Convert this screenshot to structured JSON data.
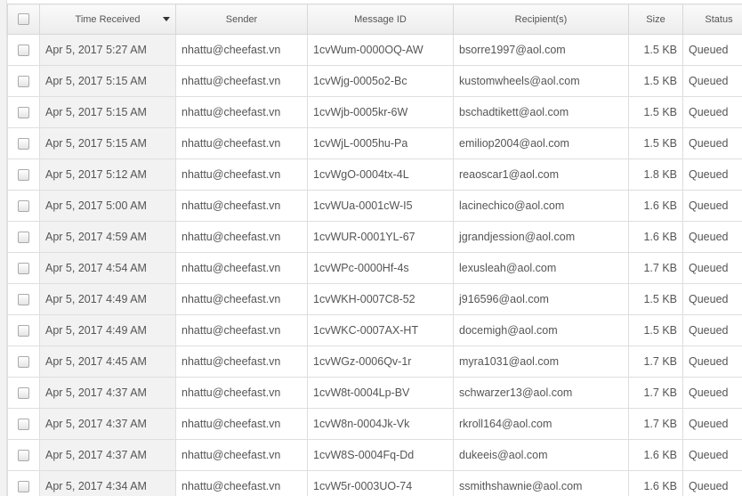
{
  "columns": {
    "time": "Time Received",
    "sender": "Sender",
    "message_id": "Message ID",
    "recipients": "Recipient(s)",
    "size": "Size",
    "status": "Status"
  },
  "sort": {
    "column": "time",
    "direction": "descending"
  },
  "rows": [
    {
      "time": "Apr 5, 2017 5:27 AM",
      "sender": "nhattu@cheefast.vn",
      "message_id": "1cvWum-0000OQ-AW",
      "recipient": "bsorre1997@aol.com",
      "size": "1.5 KB",
      "status": "Queued"
    },
    {
      "time": "Apr 5, 2017 5:15 AM",
      "sender": "nhattu@cheefast.vn",
      "message_id": "1cvWjg-0005o2-Bc",
      "recipient": "kustomwheels@aol.com",
      "size": "1.5 KB",
      "status": "Queued"
    },
    {
      "time": "Apr 5, 2017 5:15 AM",
      "sender": "nhattu@cheefast.vn",
      "message_id": "1cvWjb-0005kr-6W",
      "recipient": "bschadtikett@aol.com",
      "size": "1.5 KB",
      "status": "Queued"
    },
    {
      "time": "Apr 5, 2017 5:15 AM",
      "sender": "nhattu@cheefast.vn",
      "message_id": "1cvWjL-0005hu-Pa",
      "recipient": "emiliop2004@aol.com",
      "size": "1.5 KB",
      "status": "Queued"
    },
    {
      "time": "Apr 5, 2017 5:12 AM",
      "sender": "nhattu@cheefast.vn",
      "message_id": "1cvWgO-0004tx-4L",
      "recipient": "reaoscar1@aol.com",
      "size": "1.8 KB",
      "status": "Queued"
    },
    {
      "time": "Apr 5, 2017 5:00 AM",
      "sender": "nhattu@cheefast.vn",
      "message_id": "1cvWUa-0001cW-I5",
      "recipient": "lacinechico@aol.com",
      "size": "1.6 KB",
      "status": "Queued"
    },
    {
      "time": "Apr 5, 2017 4:59 AM",
      "sender": "nhattu@cheefast.vn",
      "message_id": "1cvWUR-0001YL-67",
      "recipient": "jgrandjession@aol.com",
      "size": "1.6 KB",
      "status": "Queued"
    },
    {
      "time": "Apr 5, 2017 4:54 AM",
      "sender": "nhattu@cheefast.vn",
      "message_id": "1cvWPc-0000Hf-4s",
      "recipient": "lexusleah@aol.com",
      "size": "1.7 KB",
      "status": "Queued"
    },
    {
      "time": "Apr 5, 2017 4:49 AM",
      "sender": "nhattu@cheefast.vn",
      "message_id": "1cvWKH-0007C8-52",
      "recipient": "j916596@aol.com",
      "size": "1.5 KB",
      "status": "Queued"
    },
    {
      "time": "Apr 5, 2017 4:49 AM",
      "sender": "nhattu@cheefast.vn",
      "message_id": "1cvWKC-0007AX-HT",
      "recipient": "docemigh@aol.com",
      "size": "1.5 KB",
      "status": "Queued"
    },
    {
      "time": "Apr 5, 2017 4:45 AM",
      "sender": "nhattu@cheefast.vn",
      "message_id": "1cvWGz-0006Qv-1r",
      "recipient": "myra1031@aol.com",
      "size": "1.7 KB",
      "status": "Queued"
    },
    {
      "time": "Apr 5, 2017 4:37 AM",
      "sender": "nhattu@cheefast.vn",
      "message_id": "1cvW8t-0004Lp-BV",
      "recipient": "schwarzer13@aol.com",
      "size": "1.7 KB",
      "status": "Queued"
    },
    {
      "time": "Apr 5, 2017 4:37 AM",
      "sender": "nhattu@cheefast.vn",
      "message_id": "1cvW8n-0004Jk-Vk",
      "recipient": "rkroll164@aol.com",
      "size": "1.7 KB",
      "status": "Queued"
    },
    {
      "time": "Apr 5, 2017 4:37 AM",
      "sender": "nhattu@cheefast.vn",
      "message_id": "1cvW8S-0004Fq-Dd",
      "recipient": "dukeeis@aol.com",
      "size": "1.6 KB",
      "status": "Queued"
    },
    {
      "time": "Apr 5, 2017 4:34 AM",
      "sender": "nhattu@cheefast.vn",
      "message_id": "1cvW5r-0003UO-74",
      "recipient": "ssmithshawnie@aol.com",
      "size": "1.6 KB",
      "status": "Queued"
    }
  ]
}
